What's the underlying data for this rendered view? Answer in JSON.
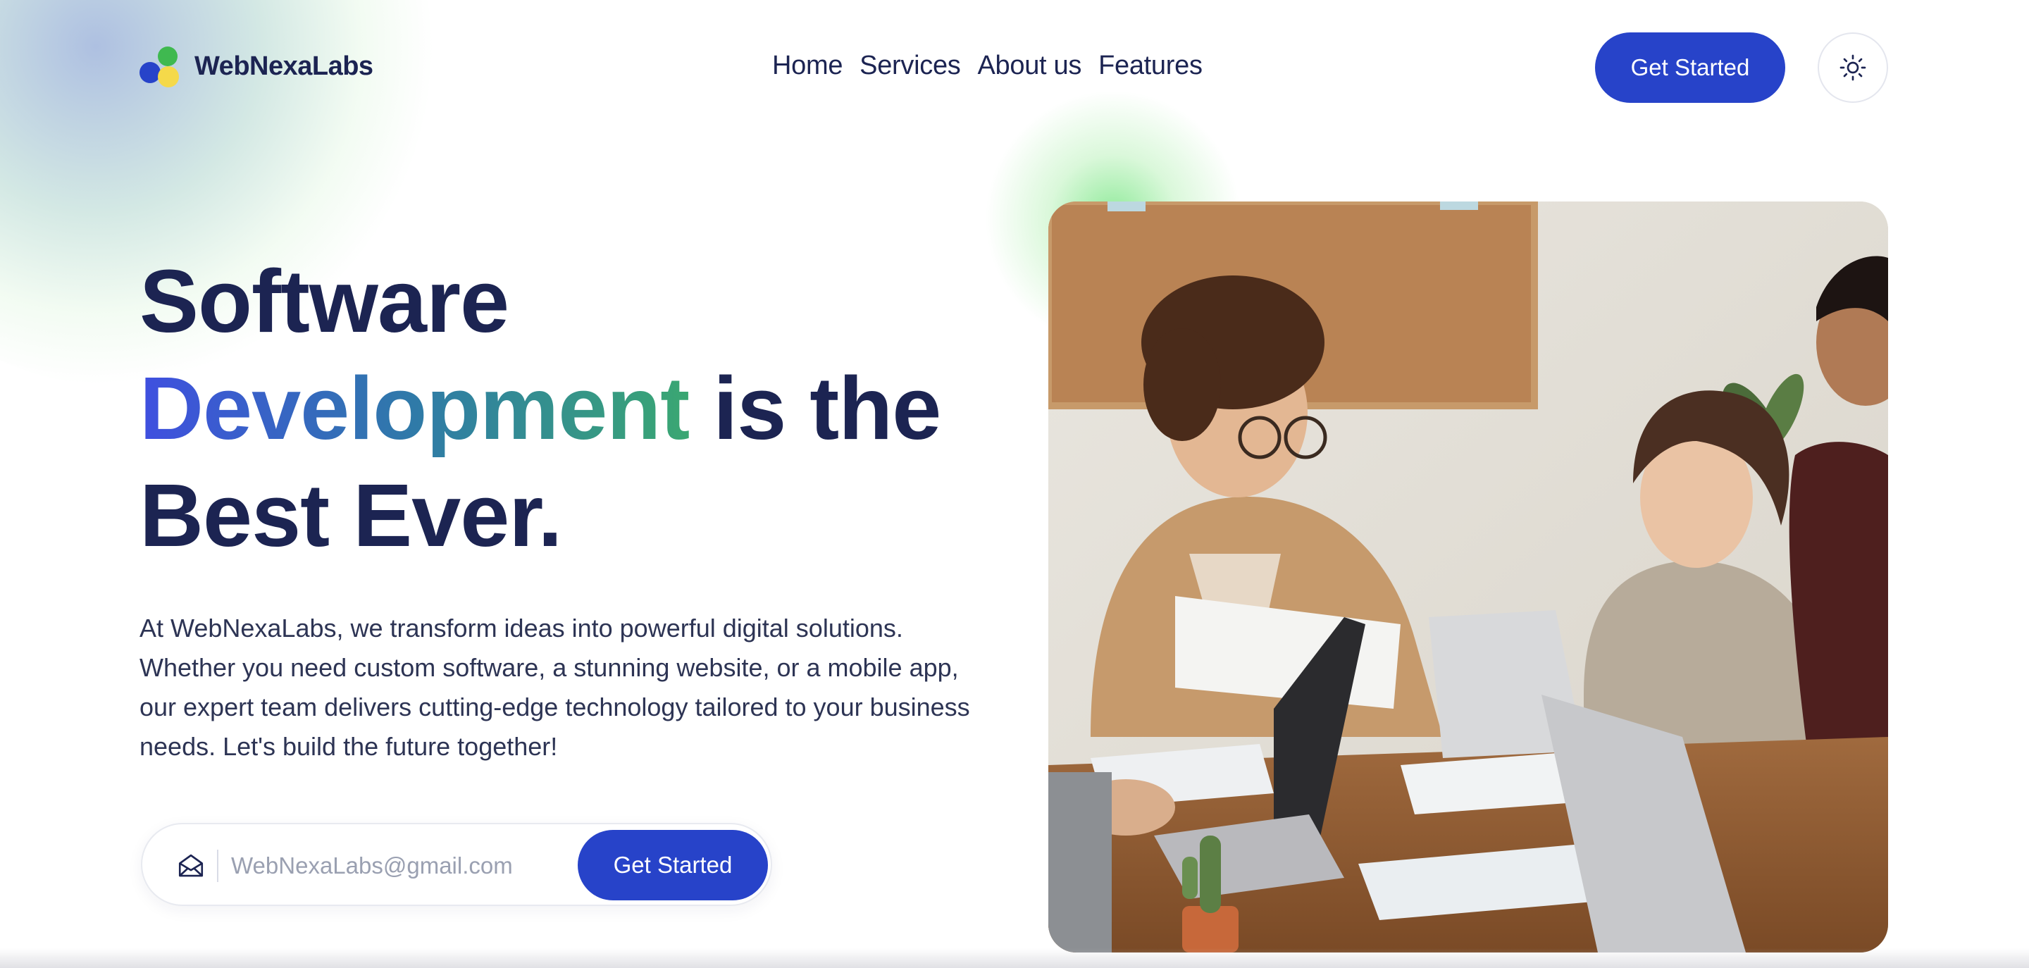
{
  "brand": {
    "name": "WebNexaLabs",
    "colors": {
      "primary": "#2743c9",
      "dark": "#1c2452",
      "logo_green": "#3fb950",
      "logo_yellow": "#f5d94a"
    }
  },
  "nav": {
    "items": [
      {
        "label": "Home"
      },
      {
        "label": "Services"
      },
      {
        "label": "About us"
      },
      {
        "label": "Features"
      }
    ]
  },
  "header": {
    "cta_label": "Get Started",
    "theme_toggle_icon": "sun-icon"
  },
  "hero": {
    "title_line1": "Software",
    "title_highlight": "Development",
    "title_line2_rest": "is the",
    "title_line3": "Best Ever.",
    "description": "At WebNexaLabs, we transform ideas into powerful digital solutions. Whether you need custom software, a stunning website, or a mobile app, our expert team delivers cutting-edge technology tailored to your business needs. Let's build the future together!",
    "image_subject": "team-meeting-photo"
  },
  "signup": {
    "icon": "envelope-icon",
    "email_placeholder": "WebNexaLabs@gmail.com",
    "email_value": "",
    "cta_label": "Get Started"
  }
}
